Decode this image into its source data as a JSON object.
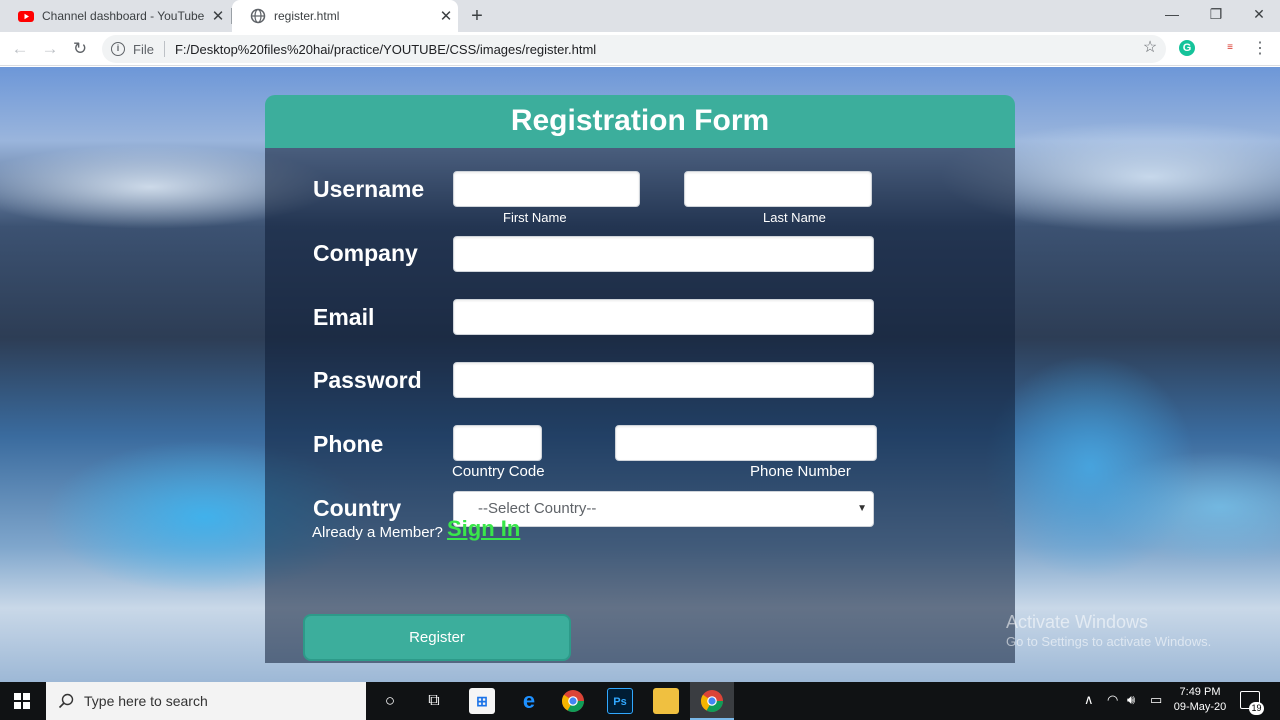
{
  "browser": {
    "tabs": [
      {
        "title": "Channel dashboard - YouTube St",
        "icon": "youtube-icon",
        "active": false
      },
      {
        "title": "register.html",
        "icon": "globe-icon",
        "active": true
      }
    ],
    "address": {
      "scheme": "File",
      "url": "F:/Desktop%20files%20hai/practice/YOUTUBE/CSS/images/register.html"
    }
  },
  "form": {
    "title": "Registration Form",
    "fields": {
      "username": {
        "label": "Username",
        "first_name": "First Name",
        "last_name": "Last Name"
      },
      "company": {
        "label": "Company"
      },
      "email": {
        "label": "Email"
      },
      "password": {
        "label": "Password"
      },
      "phone": {
        "label": "Phone",
        "country_code": "Country Code",
        "phone_number": "Phone Number"
      },
      "country": {
        "label": "Country",
        "selected": "--Select Country--"
      }
    },
    "member_text": "Already a Member?",
    "signin_label": "Sign In",
    "register_label": "Register"
  },
  "watermark": {
    "line1": "Activate Windows",
    "line2": "Go to Settings to activate Windows."
  },
  "taskbar": {
    "search_placeholder": "Type here to search",
    "time": "7:49 PM",
    "date": "09-May-20",
    "notification_count": "19"
  },
  "colors": {
    "accent": "#3cae9c",
    "signin": "#39e64a",
    "taskbar": "#101214"
  }
}
